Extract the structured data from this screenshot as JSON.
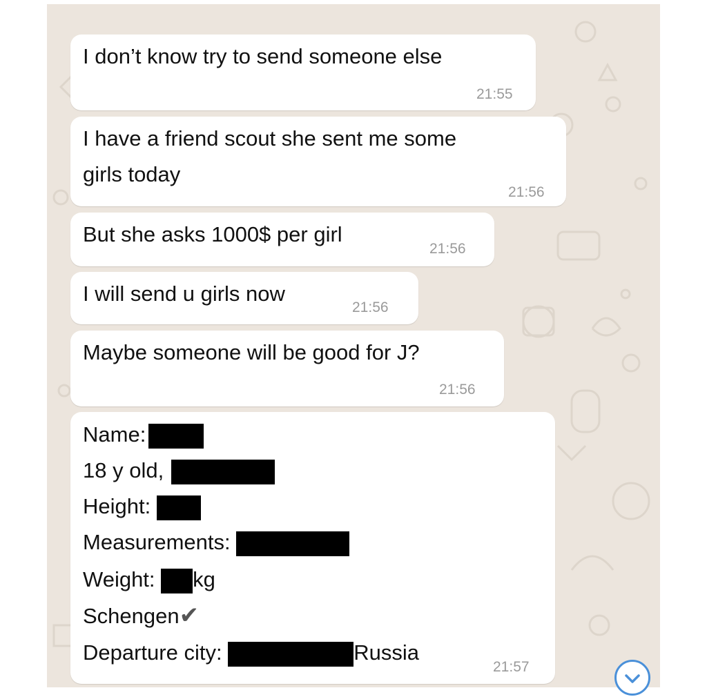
{
  "messages": [
    {
      "text": "I don’t know try to send someone else",
      "time": "21:55"
    },
    {
      "text": "I have a friend scout she sent me some",
      "text2": "girls today",
      "time": "21:56"
    },
    {
      "text": "But she asks 1000$  per girl",
      "time": "21:56"
    },
    {
      "text": "I will send u girls now",
      "time": "21:56"
    },
    {
      "text": "Maybe someone will be good for J?",
      "time": "21:56"
    }
  ],
  "profile": {
    "name_label": "Name:",
    "age_label": "18 y old,",
    "height_label": "Height:",
    "measurements_label": "Measurements:",
    "weight_label": "Weight:",
    "weight_unit": "kg",
    "schengen_label": "Schengen",
    "departure_label": "Departure city:",
    "departure_country": "Russia",
    "time": "21:57"
  },
  "icons": {
    "checkmark": "checkmark-icon",
    "scroll_down": "chevron-down-icon"
  },
  "colors": {
    "chat_background": "#ece5dd",
    "bubble": "#ffffff",
    "timestamp": "#9a9a9a",
    "redaction": "#000000",
    "scroll_button_accent": "#4a90d9"
  }
}
